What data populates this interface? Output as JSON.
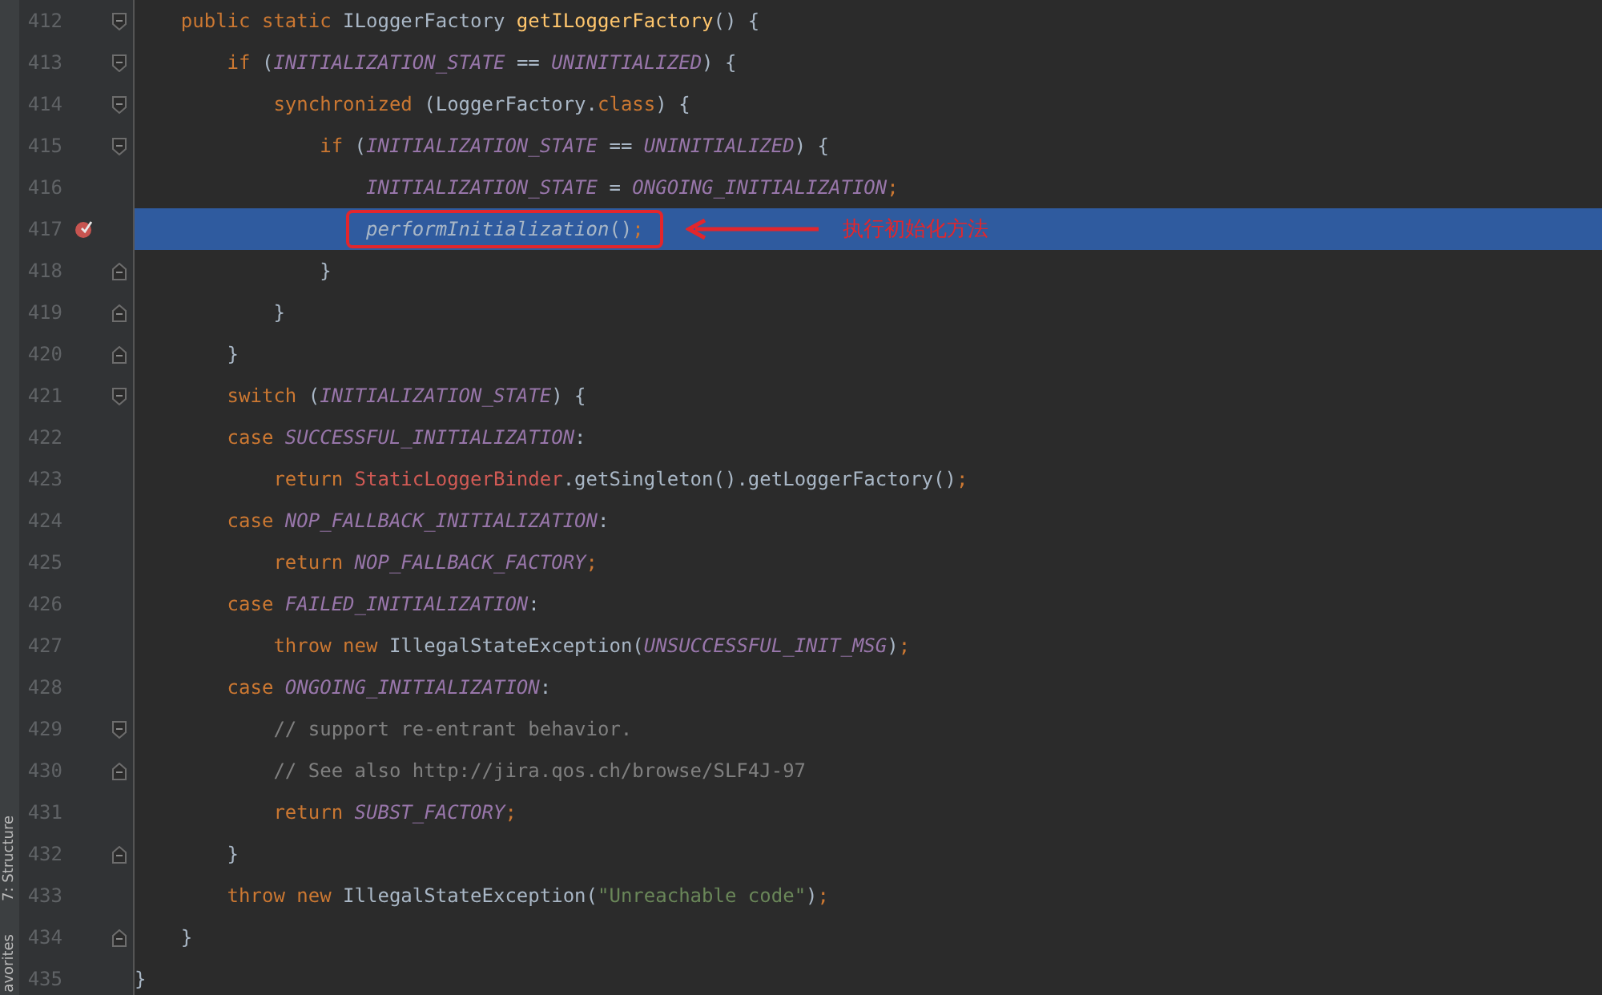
{
  "tool_strip": [
    {
      "label": "7: Structure"
    },
    {
      "label": "avorites"
    }
  ],
  "lines": [
    {
      "number": "412",
      "current": false,
      "breakpoint": false,
      "fold_start": true,
      "fold_end": false,
      "tokens": [
        {
          "kind": "kw",
          "text": "    public static "
        },
        {
          "kind": "plain",
          "text": "ILoggerFactory "
        },
        {
          "kind": "fn",
          "text": "getILoggerFactory"
        },
        {
          "kind": "plain",
          "text": "() {"
        }
      ]
    },
    {
      "number": "413",
      "current": false,
      "breakpoint": false,
      "fold_start": true,
      "fold_end": false,
      "tokens": [
        {
          "kind": "kw",
          "text": "        if "
        },
        {
          "kind": "plain",
          "text": "("
        },
        {
          "kind": "const",
          "text": "INITIALIZATION_STATE"
        },
        {
          "kind": "plain",
          "text": " == "
        },
        {
          "kind": "const",
          "text": "UNINITIALIZED"
        },
        {
          "kind": "plain",
          "text": ") {"
        }
      ]
    },
    {
      "number": "414",
      "current": false,
      "breakpoint": false,
      "fold_start": true,
      "fold_end": false,
      "tokens": [
        {
          "kind": "kw",
          "text": "            synchronized "
        },
        {
          "kind": "plain",
          "text": "(LoggerFactory."
        },
        {
          "kind": "kw",
          "text": "class"
        },
        {
          "kind": "plain",
          "text": ") {"
        }
      ]
    },
    {
      "number": "415",
      "current": false,
      "breakpoint": false,
      "fold_start": true,
      "fold_end": false,
      "tokens": [
        {
          "kind": "kw",
          "text": "                if "
        },
        {
          "kind": "plain",
          "text": "("
        },
        {
          "kind": "const",
          "text": "INITIALIZATION_STATE"
        },
        {
          "kind": "plain",
          "text": " == "
        },
        {
          "kind": "const",
          "text": "UNINITIALIZED"
        },
        {
          "kind": "plain",
          "text": ") {"
        }
      ]
    },
    {
      "number": "416",
      "current": false,
      "breakpoint": false,
      "fold_start": false,
      "fold_end": false,
      "tokens": [
        {
          "kind": "const",
          "text": "                    INITIALIZATION_STATE"
        },
        {
          "kind": "plain",
          "text": " = "
        },
        {
          "kind": "const",
          "text": "ONGOING_INITIALIZATION"
        },
        {
          "kind": "kw",
          "text": ";"
        }
      ]
    },
    {
      "number": "417",
      "current": true,
      "breakpoint": true,
      "fold_start": false,
      "fold_end": false,
      "callout": {
        "tokens": [
          {
            "kind": "static",
            "text": "performInitialization"
          },
          {
            "kind": "plain",
            "text": "()"
          },
          {
            "kind": "kw",
            "text": ";"
          }
        ],
        "note": "执行初始化方法"
      }
    },
    {
      "number": "418",
      "current": false,
      "breakpoint": false,
      "fold_start": false,
      "fold_end": true,
      "tokens": [
        {
          "kind": "plain",
          "text": "                }"
        }
      ]
    },
    {
      "number": "419",
      "current": false,
      "breakpoint": false,
      "fold_start": false,
      "fold_end": true,
      "tokens": [
        {
          "kind": "plain",
          "text": "            }"
        }
      ]
    },
    {
      "number": "420",
      "current": false,
      "breakpoint": false,
      "fold_start": false,
      "fold_end": true,
      "tokens": [
        {
          "kind": "plain",
          "text": "        }"
        }
      ]
    },
    {
      "number": "421",
      "current": false,
      "breakpoint": false,
      "fold_start": true,
      "fold_end": false,
      "tokens": [
        {
          "kind": "kw",
          "text": "        switch "
        },
        {
          "kind": "plain",
          "text": "("
        },
        {
          "kind": "const",
          "text": "INITIALIZATION_STATE"
        },
        {
          "kind": "plain",
          "text": ") {"
        }
      ]
    },
    {
      "number": "422",
      "current": false,
      "breakpoint": false,
      "fold_start": false,
      "fold_end": false,
      "tokens": [
        {
          "kind": "kw",
          "text": "        case "
        },
        {
          "kind": "const",
          "text": "SUCCESSFUL_INITIALIZATION"
        },
        {
          "kind": "plain",
          "text": ":"
        }
      ]
    },
    {
      "number": "423",
      "current": false,
      "breakpoint": false,
      "fold_start": false,
      "fold_end": false,
      "tokens": [
        {
          "kind": "kw",
          "text": "            return "
        },
        {
          "kind": "cls",
          "text": "StaticLoggerBinder"
        },
        {
          "kind": "plain",
          "text": ".getSingleton().getLoggerFactory()"
        },
        {
          "kind": "kw",
          "text": ";"
        }
      ]
    },
    {
      "number": "424",
      "current": false,
      "breakpoint": false,
      "fold_start": false,
      "fold_end": false,
      "tokens": [
        {
          "kind": "kw",
          "text": "        case "
        },
        {
          "kind": "const",
          "text": "NOP_FALLBACK_INITIALIZATION"
        },
        {
          "kind": "plain",
          "text": ":"
        }
      ]
    },
    {
      "number": "425",
      "current": false,
      "breakpoint": false,
      "fold_start": false,
      "fold_end": false,
      "tokens": [
        {
          "kind": "kw",
          "text": "            return "
        },
        {
          "kind": "const",
          "text": "NOP_FALLBACK_FACTORY"
        },
        {
          "kind": "kw",
          "text": ";"
        }
      ]
    },
    {
      "number": "426",
      "current": false,
      "breakpoint": false,
      "fold_start": false,
      "fold_end": false,
      "tokens": [
        {
          "kind": "kw",
          "text": "        case "
        },
        {
          "kind": "const",
          "text": "FAILED_INITIALIZATION"
        },
        {
          "kind": "plain",
          "text": ":"
        }
      ]
    },
    {
      "number": "427",
      "current": false,
      "breakpoint": false,
      "fold_start": false,
      "fold_end": false,
      "tokens": [
        {
          "kind": "kw",
          "text": "            throw new "
        },
        {
          "kind": "plain",
          "text": "IllegalStateException("
        },
        {
          "kind": "const",
          "text": "UNSUCCESSFUL_INIT_MSG"
        },
        {
          "kind": "plain",
          "text": ")"
        },
        {
          "kind": "kw",
          "text": ";"
        }
      ]
    },
    {
      "number": "428",
      "current": false,
      "breakpoint": false,
      "fold_start": false,
      "fold_end": false,
      "tokens": [
        {
          "kind": "kw",
          "text": "        case "
        },
        {
          "kind": "const",
          "text": "ONGOING_INITIALIZATION"
        },
        {
          "kind": "plain",
          "text": ":"
        }
      ]
    },
    {
      "number": "429",
      "current": false,
      "breakpoint": false,
      "fold_start": true,
      "fold_end": false,
      "tokens": [
        {
          "kind": "comment",
          "text": "            // support re-entrant behavior."
        }
      ]
    },
    {
      "number": "430",
      "current": false,
      "breakpoint": false,
      "fold_start": false,
      "fold_end": true,
      "tokens": [
        {
          "kind": "comment",
          "text": "            // See also http://jira.qos.ch/browse/SLF4J-97"
        }
      ]
    },
    {
      "number": "431",
      "current": false,
      "breakpoint": false,
      "fold_start": false,
      "fold_end": false,
      "tokens": [
        {
          "kind": "kw",
          "text": "            return "
        },
        {
          "kind": "const",
          "text": "SUBST_FACTORY"
        },
        {
          "kind": "kw",
          "text": ";"
        }
      ]
    },
    {
      "number": "432",
      "current": false,
      "breakpoint": false,
      "fold_start": false,
      "fold_end": true,
      "tokens": [
        {
          "kind": "plain",
          "text": "        }"
        }
      ]
    },
    {
      "number": "433",
      "current": false,
      "breakpoint": false,
      "fold_start": false,
      "fold_end": false,
      "tokens": [
        {
          "kind": "kw",
          "text": "        throw new "
        },
        {
          "kind": "plain",
          "text": "IllegalStateException("
        },
        {
          "kind": "str",
          "text": "\"Unreachable code\""
        },
        {
          "kind": "plain",
          "text": ")"
        },
        {
          "kind": "kw",
          "text": ";"
        }
      ]
    },
    {
      "number": "434",
      "current": false,
      "breakpoint": false,
      "fold_start": false,
      "fold_end": true,
      "tokens": [
        {
          "kind": "plain",
          "text": "    }"
        }
      ]
    },
    {
      "number": "435",
      "current": false,
      "breakpoint": false,
      "fold_start": false,
      "fold_end": false,
      "tokens": [
        {
          "kind": "plain",
          "text": "}"
        }
      ]
    }
  ]
}
